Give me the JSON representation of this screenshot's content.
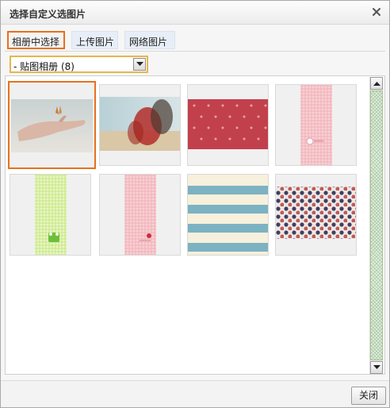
{
  "dialog": {
    "title": "选择自定义选图片",
    "close_icon": "close-icon"
  },
  "tabs": [
    {
      "label": "相册中选择",
      "active": true
    },
    {
      "label": "上传图片",
      "active": false
    },
    {
      "label": "网络图片",
      "active": false
    }
  ],
  "album_select": {
    "selected": "- 贴图相册 (8)",
    "arrow_icon": "chevron-down-icon"
  },
  "thumbnails": [
    {
      "name": "hand-with-butterfly",
      "selected": true
    },
    {
      "name": "blurred-girl-red-scarf",
      "selected": false
    },
    {
      "name": "red-polka-dot-pattern",
      "selected": false
    },
    {
      "name": "pink-gingham-strip",
      "selected": false
    },
    {
      "name": "green-gingham-strip",
      "selected": false
    },
    {
      "name": "pink-gingham-strip-2",
      "selected": false
    },
    {
      "name": "blue-cream-stripes",
      "selected": false
    },
    {
      "name": "navy-red-dots-pattern",
      "selected": false
    }
  ],
  "footer": {
    "close_label": "关闭"
  },
  "colors": {
    "selection_border": "#e8711d",
    "select_border": "#e5b650",
    "tab_bg": "#e8eef7"
  }
}
